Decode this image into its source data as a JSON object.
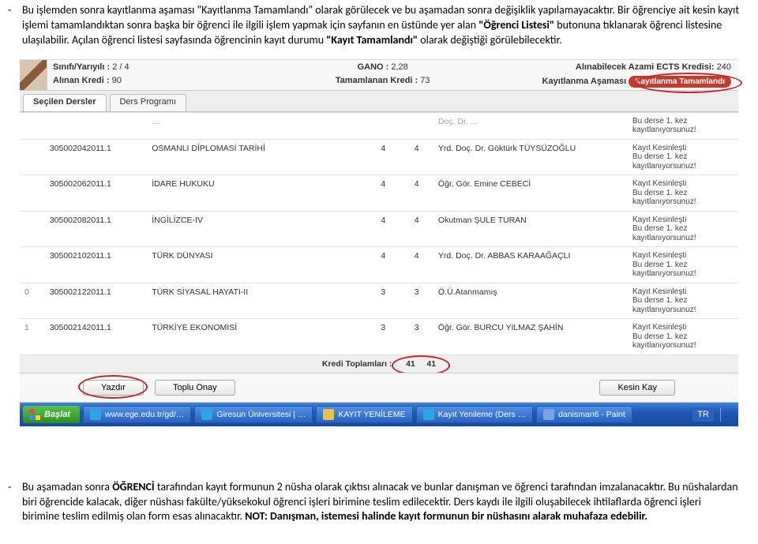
{
  "para1": {
    "prefix": "Bu işlemden sonra kayıtlanma aşaması ",
    "q1": "\"Kayıtlanma Tamamlandı\"",
    "mid1": " olarak görülecek ve bu aşamadan sonra değişiklik yapılamayacaktır. Bir öğrenciye ait kesin kayıt işlemi tamamlandıktan sonra başka bir öğrenci ile ilgili işlem yapmak için sayfanın en üstünde yer alan ",
    "q2": "\"Öğrenci Listesi\"",
    "mid2": " butonuna tıklanarak öğrenci listesine ulaşılabilir. Açılan öğrenci listesi sayfasında öğrencinin kayıt durumu ",
    "q3": "\"Kayıt Tamamlandı\"",
    "suffix": " olarak değiştiği görülebilecektir."
  },
  "para2": {
    "a": "Bu aşamadan sonra ",
    "b": "ÖĞRENCİ",
    "c": " tarafından kayıt formunun 2 nüsha olarak çıktısı alınacak ve bunlar danışman ve öğrenci tarafından imzalanacaktır. Bu nüshalardan biri öğrencide kalacak, diğer nüshası fakülte/yüksekokul öğrenci işleri birimine teslim edilecektir. Ders kaydı ile ilgili oluşabilecek ihtilaflarda öğrenci işleri birimine teslim edilmiş olan form esas alınacaktır. ",
    "d": "NOT: Danışman, istemesi halinde kayıt formunun bir nüshasını alarak muhafaza edebilir."
  },
  "header": {
    "sinif_lbl": "Sınıfı/Yarıyılı :",
    "sinif_val": "2 / 4",
    "gano_lbl": "GANO :",
    "gano_val": "2,28",
    "ects_lbl": "Alınabilecek Azami ECTS Kredisi:",
    "ects_val": "240",
    "alinan_lbl": "Alınan Kredi :",
    "alinan_val": "90",
    "tamam_lbl": "Tamamlanan Kredi :",
    "tamam_val": "73",
    "asama_lbl": "Kayıtlanma Aşaması",
    "asama_badge": "Kayıtlanma Tamamlandı"
  },
  "tabs": {
    "t1": "Seçilen Dersler",
    "t2": "Ders Programı"
  },
  "rows": [
    {
      "pre": "",
      "code": "305002042011.1",
      "name": "OSMANLI DİPLOMASİ TARİHİ",
      "c1": "4",
      "c2": "4",
      "lec": "Yrd. Doç. Dr. Göktürk TÜYSÜZOĞLU"
    },
    {
      "pre": "",
      "code": "305002062011.1",
      "name": "İDARE HUKUKU",
      "c1": "4",
      "c2": "4",
      "lec": "Öğr. Gör. Emine CEBECİ"
    },
    {
      "pre": "",
      "code": "305002082011.1",
      "name": "İNGİLİZCE-IV",
      "c1": "4",
      "c2": "4",
      "lec": "Okutman ŞULE TURAN"
    },
    {
      "pre": "",
      "code": "305002102011.1",
      "name": "TÜRK DÜNYASI",
      "c1": "4",
      "c2": "4",
      "lec": "Yrd. Doç. Dr. ABBAS KARAAĞAÇLI"
    },
    {
      "pre": "0",
      "code": "305002122011.1",
      "name": "TÜRK SİYASAL HAYATI-II",
      "c1": "3",
      "c2": "3",
      "lec": "Ö.Ü.Atanmamış"
    },
    {
      "pre": "1",
      "code": "305002142011.1",
      "name": "TÜRKİYE EKONOMİSİ",
      "c1": "3",
      "c2": "3",
      "lec": "Öğr. Gör. BURCU YILMAZ ŞAHİN"
    }
  ],
  "top_row": {
    "lec_partial": "Doç. Dr. ...",
    "status_a": "Bu derse 1. kez",
    "status_b": "kayıtlanıyorsunuz!"
  },
  "status": {
    "a": "Kayıt Kesinleşti",
    "b": "Bu derse 1. kez",
    "c": "kayıtlanıyorsunuz!"
  },
  "totals": {
    "label": "Kredi Toplamları :",
    "v1": "41",
    "v2": "41"
  },
  "buttons": {
    "yazdir": "Yazdır",
    "onay": "Toplu Onay",
    "kesin": "Kesin Kay"
  },
  "taskbar": {
    "start": "Başlat",
    "items": [
      {
        "label": "www.ege.edu.tr/gd/…",
        "color": "#2aa6e8"
      },
      {
        "label": "Giresun Üniversitesi | …",
        "color": "#2aa6e8"
      },
      {
        "label": "KAYIT YENİLEME",
        "color": "#e6c24a"
      },
      {
        "label": "Kayıt Yenileme (Ders …",
        "color": "#2aa6e8"
      },
      {
        "label": "danisman6 - Paint",
        "color": "#7aa3e6"
      }
    ],
    "lang": "TR"
  }
}
